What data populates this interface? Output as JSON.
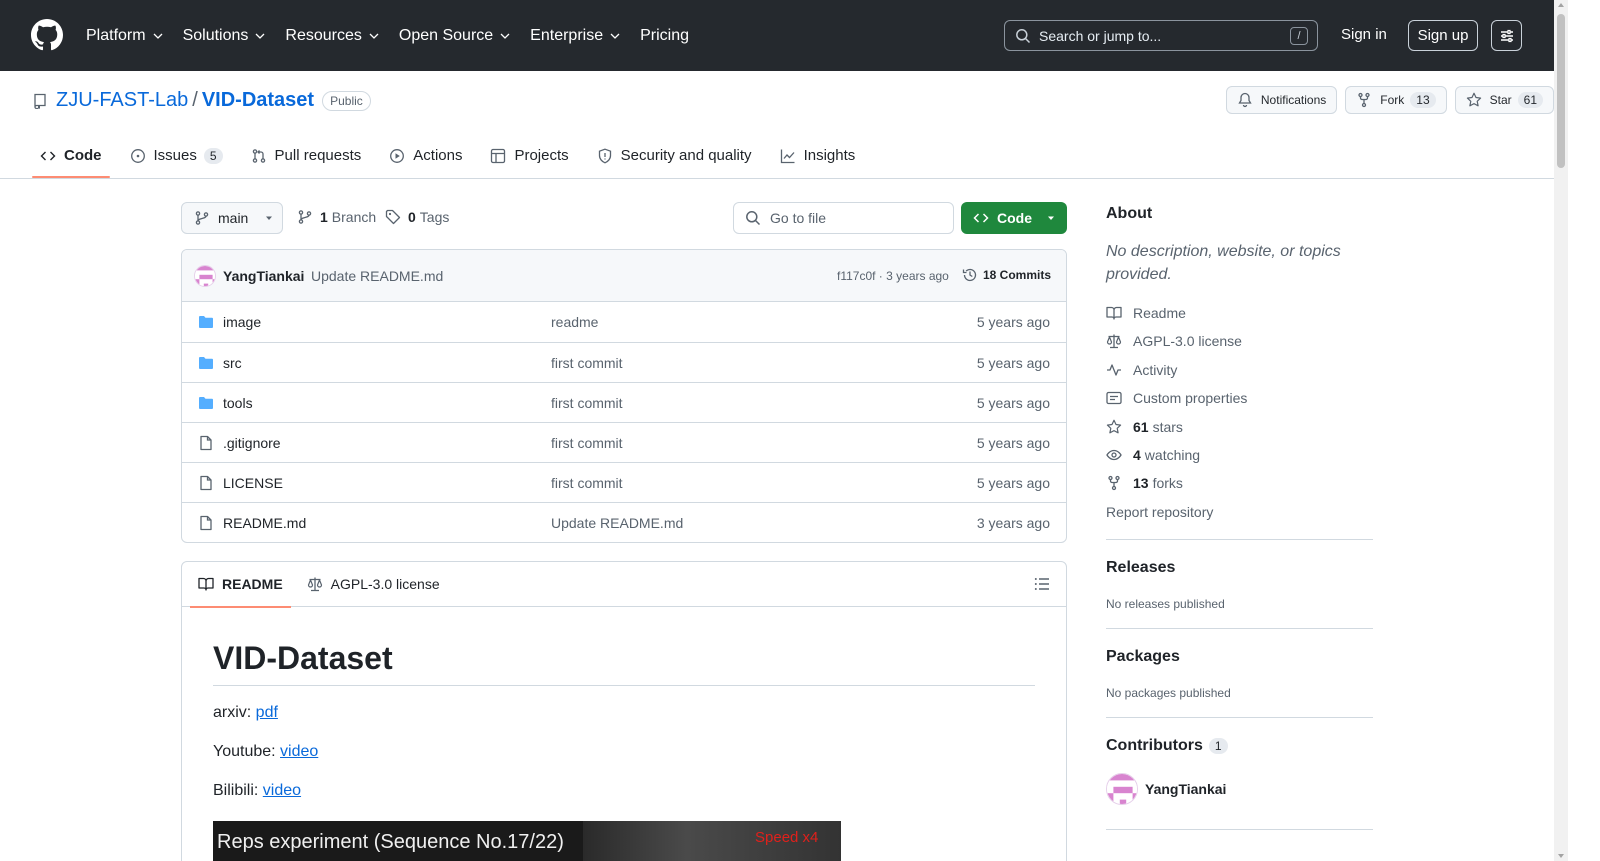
{
  "header": {
    "nav": [
      "Platform",
      "Solutions",
      "Resources",
      "Open Source",
      "Enterprise",
      "Pricing"
    ],
    "search_placeholder": "Search or jump to...",
    "search_shortcut": "/",
    "sign_in": "Sign in",
    "sign_up": "Sign up"
  },
  "repo": {
    "owner": "ZJU-FAST-Lab",
    "separator": "/",
    "name": "VID-Dataset",
    "visibility": "Public",
    "notifications": "Notifications",
    "fork_label": "Fork",
    "fork_count": "13",
    "star_label": "Star",
    "star_count": "61"
  },
  "tabs": {
    "code": "Code",
    "issues": "Issues",
    "issues_count": "5",
    "pulls": "Pull requests",
    "actions": "Actions",
    "projects": "Projects",
    "security": "Security and quality",
    "insights": "Insights"
  },
  "filenav": {
    "branch": "main",
    "branch_count": "1",
    "branch_label": "Branch",
    "tag_count": "0",
    "tag_label": "Tags",
    "goto_placeholder": "Go to file",
    "code_button": "Code"
  },
  "latest_commit": {
    "author": "YangTiankai",
    "message": "Update README.md",
    "hash_time": "f117c0f · 3 years ago",
    "commits": "18 Commits"
  },
  "files": [
    {
      "name": "image",
      "type": "folder",
      "message": "readme",
      "date": "5 years ago"
    },
    {
      "name": "src",
      "type": "folder",
      "message": "first commit",
      "date": "5 years ago"
    },
    {
      "name": "tools",
      "type": "folder",
      "message": "first commit",
      "date": "5 years ago"
    },
    {
      "name": ".gitignore",
      "type": "file",
      "message": "first commit",
      "date": "5 years ago"
    },
    {
      "name": "LICENSE",
      "type": "file",
      "message": "first commit",
      "date": "5 years ago"
    },
    {
      "name": "README.md",
      "type": "file",
      "message": "Update README.md",
      "date": "3 years ago"
    }
  ],
  "readme": {
    "tab_readme": "README",
    "tab_license": "AGPL-3.0 license",
    "title": "VID-Dataset",
    "lines": [
      {
        "label": "arxiv: ",
        "link": "pdf"
      },
      {
        "label": "Youtube: ",
        "link": "video"
      },
      {
        "label": "Bilibili: ",
        "link": "video"
      }
    ],
    "image_caption": "Reps experiment (Sequence No.17/22)",
    "image_speed": "Speed x4"
  },
  "about": {
    "heading": "About",
    "description": "No description, website, or topics provided.",
    "readme": "Readme",
    "license": "AGPL-3.0 license",
    "activity": "Activity",
    "custom_properties": "Custom properties",
    "stars_count": "61",
    "stars_label": "stars",
    "watching_count": "4",
    "watching_label": "watching",
    "forks_count": "13",
    "forks_label": "forks",
    "report": "Report repository"
  },
  "releases": {
    "heading": "Releases",
    "empty": "No releases published"
  },
  "packages": {
    "heading": "Packages",
    "empty": "No packages published"
  },
  "contributors": {
    "heading": "Contributors",
    "count": "1",
    "name": "YangTiankai"
  },
  "colors": {
    "header_bg": "#25292e",
    "link": "#0969da",
    "code_button": "#1f883d",
    "tab_underline": "#fd8c73",
    "folder": "#54aeff"
  }
}
